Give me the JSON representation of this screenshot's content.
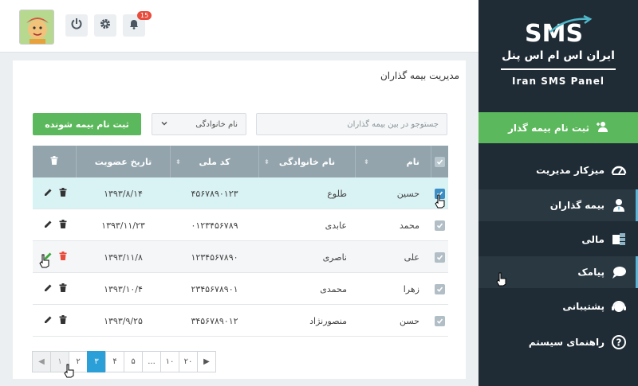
{
  "brand": {
    "logo_text": "SMS",
    "name_fa": "ایران اس ام اس پنل",
    "name_en": "Iran SMS Panel"
  },
  "sidebar": {
    "add_button": "ثبت نام بیمه گذار",
    "items": [
      {
        "label": "میزکار مدیریت",
        "icon": "dashboard-icon"
      },
      {
        "label": "بیمه گذاران",
        "icon": "user-icon"
      },
      {
        "label": "مالی",
        "icon": "finance-icon"
      },
      {
        "label": "پیامک",
        "icon": "message-icon"
      },
      {
        "label": "پشتیبانی",
        "icon": "support-icon"
      },
      {
        "label": "راهنمای سیستم",
        "icon": "help-icon"
      }
    ]
  },
  "topbar": {
    "notification_count": "15"
  },
  "page": {
    "title": "مدیریت بیمه گذاران"
  },
  "toolbar": {
    "search_placeholder": "جستوجو در بین بیمه گذاران",
    "sort_value": "نام خانوادگی",
    "register_button": "ثبت نام بیمه شونده"
  },
  "table": {
    "headers": {
      "name": "نام",
      "family": "نام خانوادگی",
      "national_id": "کد ملی",
      "join_date": "تاریخ عضویت"
    },
    "rows": [
      {
        "name": "حسین",
        "family": "طلوع",
        "national_id": "۴۵۶۷۸۹۰۱۲۳",
        "join_date": "۱۳۹۳/۸/۱۴"
      },
      {
        "name": "محمد",
        "family": "عابدی",
        "national_id": "۰۱۲۳۴۵۶۷۸۹",
        "join_date": "۱۳۹۳/۱۱/۲۳"
      },
      {
        "name": "علی",
        "family": "ناصری",
        "national_id": "۱۲۳۴۵۶۷۸۹۰",
        "join_date": "۱۳۹۳/۱۱/۸"
      },
      {
        "name": "زهرا",
        "family": "محمدی",
        "national_id": "۲۳۴۵۶۷۸۹۰۱",
        "join_date": "۱۳۹۳/۱۰/۴"
      },
      {
        "name": "حسن",
        "family": "منصورنژاد",
        "national_id": "۳۴۵۶۷۸۹۰۱۲",
        "join_date": "۱۳۹۳/۹/۲۵"
      }
    ]
  },
  "pagination": {
    "prev": "◀",
    "next": "▶",
    "pages": [
      "۱",
      "۲",
      "۳",
      "۴",
      "۵",
      "...",
      "۱۰",
      "۲۰"
    ],
    "current": "۳"
  },
  "colors": {
    "sidebar": "#1f2c35",
    "accent_green": "#5cb85c",
    "table_header": "#93a4ad",
    "highlight_row": "#d9f2f4",
    "pager_active": "#2b9fd8"
  }
}
